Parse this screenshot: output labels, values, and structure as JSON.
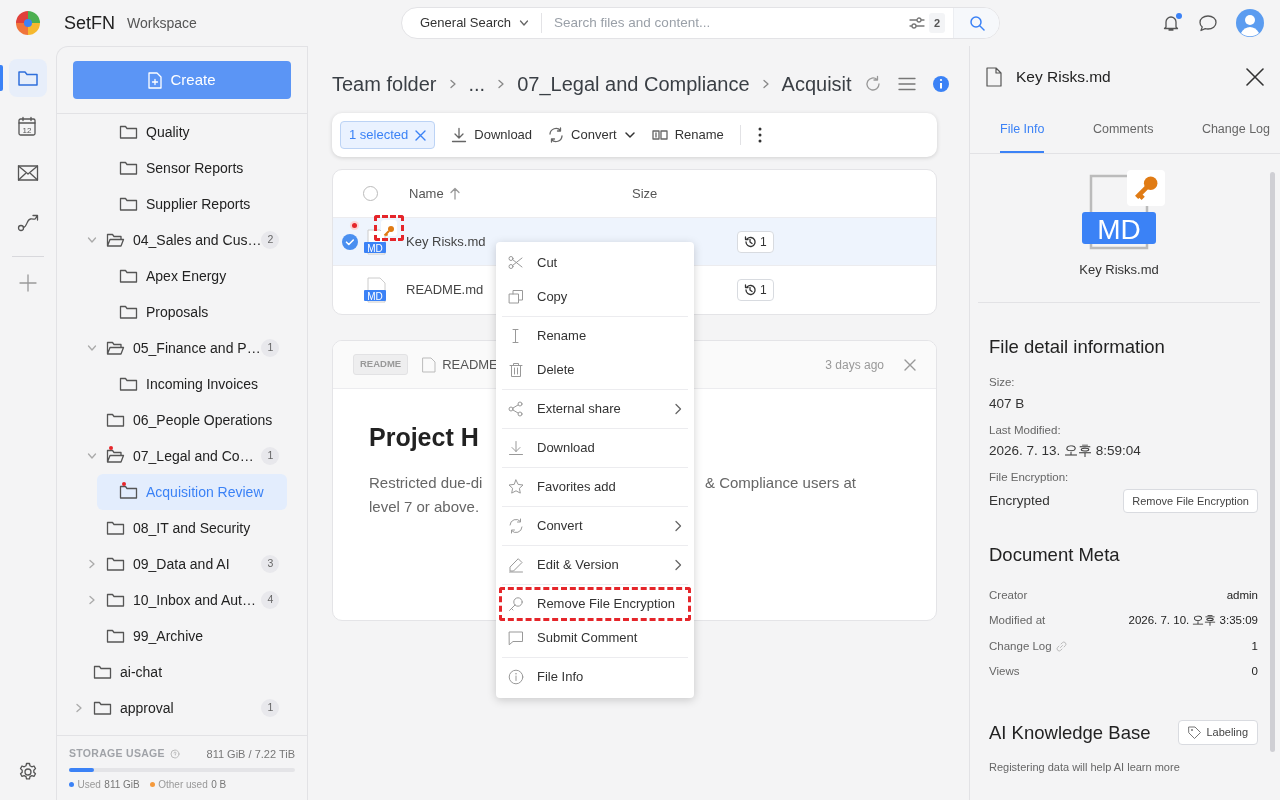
{
  "app": {
    "name": "SetFN",
    "subtitle": "Workspace"
  },
  "search": {
    "scope": "General Search",
    "placeholder": "Search files and content...",
    "filter_count": "2"
  },
  "header": {
    "unread_notifications": true
  },
  "rail": [
    {
      "selected": true
    },
    {
      "selected": false,
      "label": "12"
    },
    {
      "selected": false
    },
    {
      "selected": false
    }
  ],
  "sidebar": {
    "create_label": "Create",
    "tree": [
      {
        "children": [
          {
            "children": [
              {
                "label": "Quality",
                "selected": false,
                "flagged": false
              },
              {
                "label": "Sensor Reports",
                "selected": false,
                "flagged": false
              },
              {
                "label": "Supplier Reports",
                "selected": false,
                "flagged": false
              }
            ]
          },
          {
            "label": "04_Sales and Cus…",
            "count": "2",
            "expanded": true,
            "selected": false,
            "flagged": false,
            "children": [
              {
                "label": "Apex Energy",
                "selected": false,
                "flagged": false
              },
              {
                "label": "Proposals",
                "selected": false,
                "flagged": false
              }
            ]
          },
          {
            "label": "05_Finance and P…",
            "count": "1",
            "expanded": true,
            "selected": false,
            "flagged": false,
            "children": [
              {
                "label": "Incoming Invoices",
                "selected": false,
                "flagged": false
              }
            ]
          },
          {
            "label": "06_People Operations",
            "selected": false,
            "flagged": false
          },
          {
            "label": "07_Legal and Co…",
            "count": "1",
            "expanded": true,
            "selected": false,
            "flagged": true,
            "children": [
              {
                "label": "Acquisition Review",
                "selected": true,
                "flagged": true
              }
            ]
          },
          {
            "label": "08_IT and Security",
            "selected": false,
            "flagged": false
          },
          {
            "label": "09_Data and AI",
            "count": "3",
            "expanded": false,
            "selected": false,
            "flagged": false
          },
          {
            "label": "10_Inbox and Aut…",
            "count": "4",
            "expanded": false,
            "selected": false,
            "flagged": false
          },
          {
            "label": "99_Archive",
            "selected": false,
            "flagged": false
          }
        ]
      },
      {
        "label": "ai-chat",
        "selected": false,
        "flagged": false
      },
      {
        "label": "approval",
        "count": "1",
        "expanded": false,
        "selected": false,
        "flagged": false
      }
    ],
    "storage": {
      "title": "STORAGE USAGE",
      "total": "811 GiB / 7.22 TiB",
      "level": 0.11,
      "legend": [
        {
          "label": "Used",
          "value": "811 GiB",
          "color": "#3b82f6"
        },
        {
          "label": "Other used",
          "value": "0 B",
          "color": "#f59a3c"
        }
      ]
    }
  },
  "breadcrumb": [
    "Team folder",
    "...",
    "07_Legal and Compliance",
    "Acquisit"
  ],
  "toolbar": {
    "selection": "1 selected",
    "actions": [
      {
        "label": "Download",
        "dropdown": false
      },
      {
        "label": "Convert",
        "dropdown": true
      },
      {
        "label": "Rename",
        "dropdown": false
      }
    ]
  },
  "table": {
    "columns": [
      "Name",
      "Size"
    ],
    "sorted": true,
    "all_selected": false,
    "rows": [
      {
        "name": "Key Risks.md",
        "type": "MD",
        "versions": "1",
        "selected": true,
        "encrypted": true,
        "unread": true,
        "highlighted": true
      },
      {
        "name": "README.md",
        "type": "MD",
        "versions": "1",
        "selected": false,
        "encrypted": false,
        "unread": false,
        "highlighted": false
      }
    ]
  },
  "readme": {
    "tag": "README",
    "filename": "README",
    "time": "3 days ago",
    "heading": "Project H",
    "lines": [
      {
        "left": "Restricted due-di",
        "right": "& Compliance users at"
      },
      {
        "left": "level 7 or above."
      }
    ]
  },
  "context_menu": {
    "groups": [
      [
        {
          "label": "Cut",
          "submenu": false,
          "highlighted": false
        },
        {
          "label": "Copy",
          "submenu": false,
          "highlighted": false
        }
      ],
      [
        {
          "label": "Rename",
          "submenu": false,
          "highlighted": false
        },
        {
          "label": "Delete",
          "submenu": false,
          "highlighted": false
        }
      ],
      [
        {
          "label": "External share",
          "submenu": true,
          "highlighted": false
        }
      ],
      [
        {
          "label": "Download",
          "submenu": false,
          "highlighted": false
        }
      ],
      [
        {
          "label": "Favorites add",
          "submenu": false,
          "highlighted": false
        }
      ],
      [
        {
          "label": "Convert",
          "submenu": true,
          "highlighted": false
        }
      ],
      [
        {
          "label": "Edit & Version",
          "submenu": true,
          "highlighted": false
        }
      ],
      [
        {
          "label": "Remove File Encryption",
          "submenu": false,
          "highlighted": true
        },
        {
          "label": "Submit Comment",
          "submenu": false,
          "highlighted": false
        }
      ],
      [
        {
          "label": "File Info",
          "submenu": false,
          "highlighted": false
        }
      ]
    ]
  },
  "panel": {
    "title": "Key Risks.md",
    "tabs": [
      {
        "label": "File Info",
        "selected": true
      },
      {
        "label": "Comments",
        "selected": false
      },
      {
        "label": "Change Log",
        "selected": false
      }
    ],
    "preview": {
      "type": "MD",
      "name": "Key Risks.md",
      "encrypted": true
    },
    "details": {
      "title": "File detail information",
      "fields": [
        {
          "label": "Size:",
          "value": "407 B"
        },
        {
          "label": "Last Modified:",
          "value": "2026. 7. 13. 오후 8:59:04"
        },
        {
          "label": "File Encryption:",
          "value": "Encrypted",
          "action": "Remove File Encryption"
        }
      ]
    },
    "meta": {
      "title": "Document Meta",
      "rows": [
        {
          "label": "Creator",
          "value": "admin",
          "linked": false
        },
        {
          "label": "Modified at",
          "value": "2026. 7. 10. 오후 3:35:09",
          "linked": false
        },
        {
          "label": "Change Log",
          "value": "1",
          "linked": true
        },
        {
          "label": "Views",
          "value": "0",
          "linked": false
        }
      ]
    },
    "ai": {
      "title": "AI Knowledge Base",
      "action": "Labeling",
      "note": "Registering data will help AI learn more"
    }
  }
}
